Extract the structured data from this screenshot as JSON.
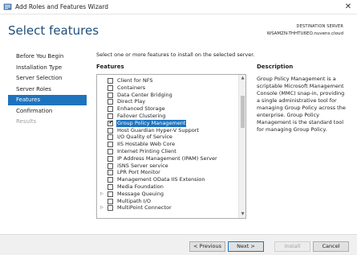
{
  "window": {
    "title": "Add Roles and Features Wizard",
    "close_glyph": "✕"
  },
  "header": {
    "page_title": "Select features",
    "destination_label": "DESTINATION SERVER",
    "destination_value": "WSAMZN-THHTU6EO.nuvens.cloud"
  },
  "nav": {
    "items": [
      {
        "label": "Before You Begin",
        "state": "normal"
      },
      {
        "label": "Installation Type",
        "state": "normal"
      },
      {
        "label": "Server Selection",
        "state": "normal"
      },
      {
        "label": "Server Roles",
        "state": "normal"
      },
      {
        "label": "Features",
        "state": "active"
      },
      {
        "label": "Confirmation",
        "state": "normal"
      },
      {
        "label": "Results",
        "state": "disabled"
      }
    ]
  },
  "main": {
    "intro": "Select one or more features to install on the selected server.",
    "features_heading": "Features",
    "description_heading": "Description",
    "description_text": "Group Policy Management is a scriptable Microsoft Management Console (MMC) snap-in, providing a single administrative tool for managing Group Policy across the enterprise. Group Policy Management is the standard tool for managing Group Policy."
  },
  "features": [
    {
      "label": "Client for NFS",
      "checked": false,
      "expander": false,
      "selected": false
    },
    {
      "label": "Containers",
      "checked": false,
      "expander": false,
      "selected": false
    },
    {
      "label": "Data Center Bridging",
      "checked": false,
      "expander": false,
      "selected": false
    },
    {
      "label": "Direct Play",
      "checked": false,
      "expander": false,
      "selected": false
    },
    {
      "label": "Enhanced Storage",
      "checked": false,
      "expander": false,
      "selected": false
    },
    {
      "label": "Failover Clustering",
      "checked": false,
      "expander": false,
      "selected": false
    },
    {
      "label": "Group Policy Management",
      "checked": true,
      "expander": false,
      "selected": true
    },
    {
      "label": "Host Guardian Hyper-V Support",
      "checked": false,
      "expander": false,
      "selected": false
    },
    {
      "label": "I/O Quality of Service",
      "checked": false,
      "expander": false,
      "selected": false
    },
    {
      "label": "IIS Hostable Web Core",
      "checked": false,
      "expander": false,
      "selected": false
    },
    {
      "label": "Internet Printing Client",
      "checked": false,
      "expander": false,
      "selected": false
    },
    {
      "label": "IP Address Management (IPAM) Server",
      "checked": false,
      "expander": false,
      "selected": false
    },
    {
      "label": "iSNS Server service",
      "checked": false,
      "expander": false,
      "selected": false
    },
    {
      "label": "LPR Port Monitor",
      "checked": false,
      "expander": false,
      "selected": false
    },
    {
      "label": "Management OData IIS Extension",
      "checked": false,
      "expander": false,
      "selected": false
    },
    {
      "label": "Media Foundation",
      "checked": false,
      "expander": false,
      "selected": false
    },
    {
      "label": "Message Queuing",
      "checked": false,
      "expander": true,
      "selected": false
    },
    {
      "label": "Multipath I/O",
      "checked": false,
      "expander": false,
      "selected": false
    },
    {
      "label": "MultiPoint Connector",
      "checked": false,
      "expander": true,
      "selected": false
    }
  ],
  "footer": {
    "previous_label": "< Previous",
    "next_label": "Next >",
    "install_label": "Install",
    "cancel_label": "Cancel"
  },
  "icons": {
    "expander_glyph": "▷",
    "check_glyph": "✔",
    "scroll_up_glyph": "▲",
    "scroll_down_glyph": "▼"
  },
  "colors": {
    "accent": "#1e73be",
    "title": "#1e4e79"
  }
}
